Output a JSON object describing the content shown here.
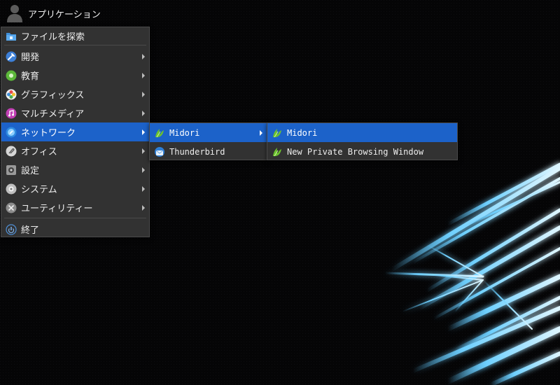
{
  "panel": {
    "title": "アプリケーション",
    "icon": "user-icon"
  },
  "main_menu": {
    "top_item": {
      "label": "ファイルを探索",
      "icon": "folder-icon"
    },
    "items": [
      {
        "label": "開発",
        "icon": "developer-tools-icon",
        "has_submenu": true
      },
      {
        "label": "教育",
        "icon": "education-icon",
        "has_submenu": true
      },
      {
        "label": "グラフィックス",
        "icon": "graphics-icon",
        "has_submenu": true
      },
      {
        "label": "マルチメディア",
        "icon": "multimedia-icon",
        "has_submenu": true
      },
      {
        "label": "ネットワーク",
        "icon": "network-icon",
        "has_submenu": true,
        "active": true
      },
      {
        "label": "オフィス",
        "icon": "office-icon",
        "has_submenu": true
      },
      {
        "label": "設定",
        "icon": "settings-icon",
        "has_submenu": true
      },
      {
        "label": "システム",
        "icon": "system-icon",
        "has_submenu": true
      },
      {
        "label": "ユーティリティー",
        "icon": "utilities-icon",
        "has_submenu": true
      }
    ],
    "bottom_item": {
      "label": "終了",
      "icon": "logout-icon"
    }
  },
  "network_menu": {
    "items": [
      {
        "label": "Midori",
        "icon": "midori-icon",
        "has_submenu": true,
        "active": true
      },
      {
        "label": "Thunderbird",
        "icon": "thunderbird-icon",
        "has_submenu": false
      }
    ]
  },
  "midori_menu": {
    "items": [
      {
        "label": "Midori",
        "icon": "midori-icon",
        "active": true
      },
      {
        "label": "New Private Browsing Window",
        "icon": "midori-icon"
      }
    ]
  },
  "colors": {
    "menu_bg": "#323232",
    "highlight": "#1c62c9",
    "desktop_bg": "#050506",
    "wallpaper_glow": "#5ec8ff"
  }
}
